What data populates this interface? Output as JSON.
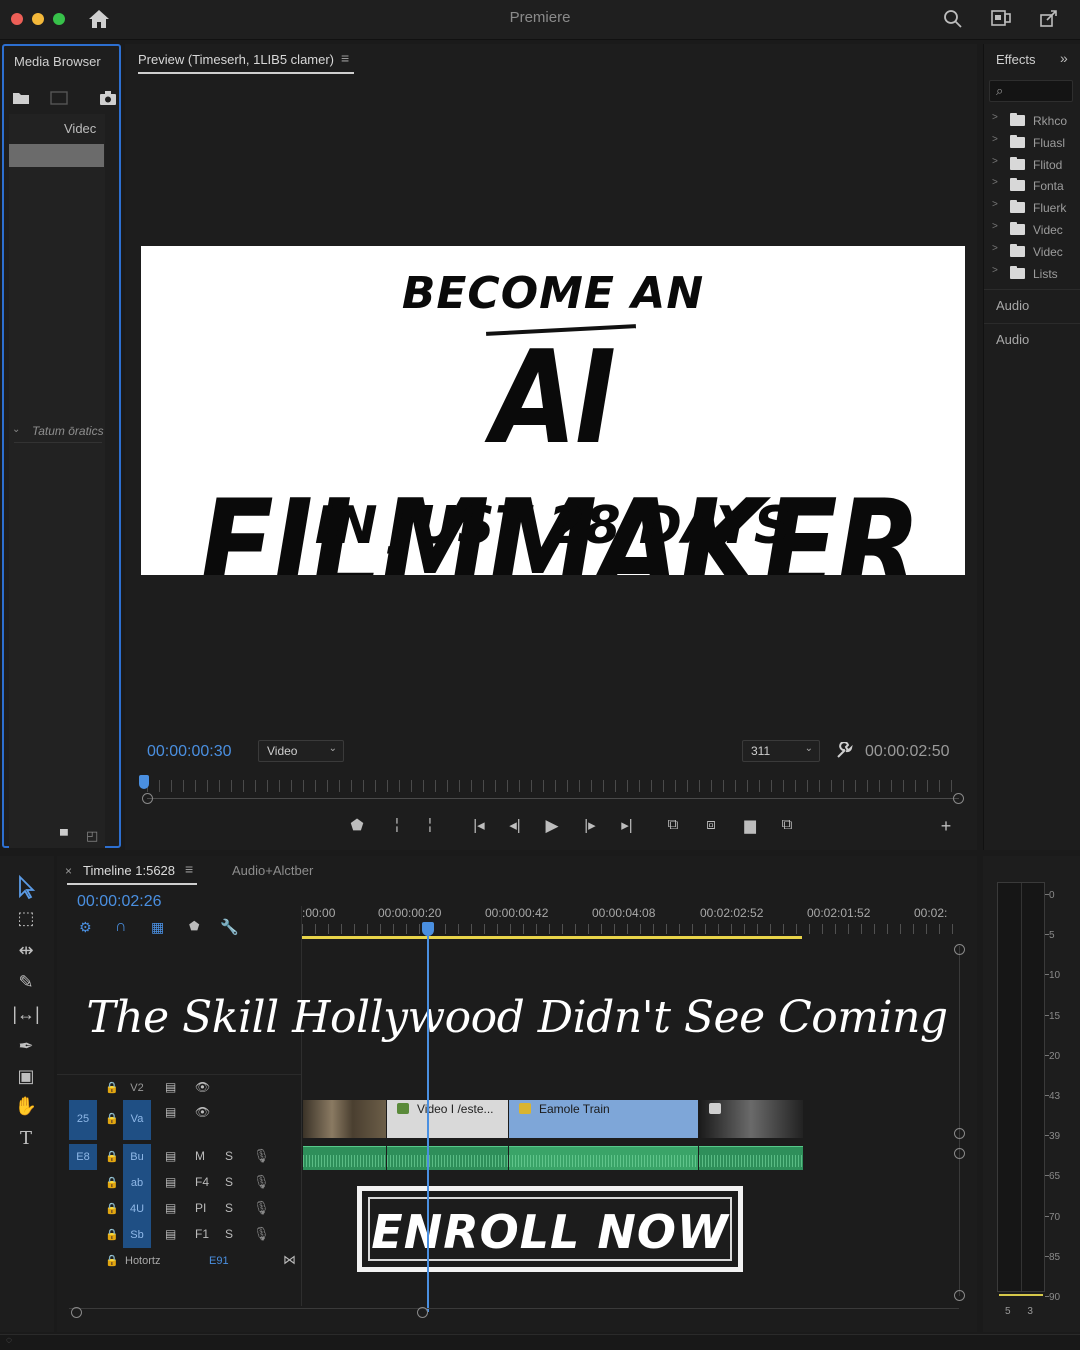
{
  "app": {
    "title": "Premiere"
  },
  "media_browser": {
    "tab": "Media Browser",
    "column": "Videc",
    "folder": "Tatum ōratics"
  },
  "preview": {
    "tab": "Preview (Timeserh, 1LIB5 clamer)",
    "frame": {
      "line1": "BECOME AN",
      "line2": "AI FILMMAKER",
      "line3": "IN JUST 28 DAYS"
    },
    "current_tc": "00:00:00:30",
    "mode_select": "Video",
    "zoom_select": "311",
    "duration_tc": "00:00:02:50"
  },
  "effects": {
    "tab": "Effects",
    "items": [
      {
        "label": "Rkhco"
      },
      {
        "label": "Fluasl"
      },
      {
        "label": "Flitod"
      },
      {
        "label": "Fonta"
      },
      {
        "label": "Fluerk"
      },
      {
        "label": "Videc"
      },
      {
        "label": "Videc"
      },
      {
        "label": "Lists"
      }
    ],
    "audio1": "Audio",
    "audio2": "Audio"
  },
  "timeline": {
    "tab": "Timeline 1:5628",
    "tab2": "Audio+Alctber",
    "tc": "00:00:02:26",
    "ruler": [
      ":00:00",
      "00:00:00:20",
      "00:00:00:42",
      "00:00:04:08",
      "00:02:02:52",
      "00:02:01:52",
      "00:02:"
    ],
    "tagline": "The Skill Hollywood Didn't See Coming",
    "tracks": {
      "v2": "V2",
      "v1": "Va",
      "v1_target": "25",
      "a1_target": "E8",
      "a1": "Bu",
      "a2": "ab",
      "a3": "4U",
      "a4": "Sb",
      "a1_m": "M",
      "a2_m": "F4",
      "a3_m": "PI",
      "a4_m": "F1",
      "solo": "S",
      "master": "Hotortz",
      "master_val": "E91"
    },
    "clips": [
      {
        "label": ""
      },
      {
        "label": "Video I /este..."
      },
      {
        "label": "Eamole Train"
      },
      {
        "label": ""
      }
    ],
    "enroll": "ENROLL NOW"
  },
  "meter": {
    "labels": [
      "0",
      "5",
      "10",
      "15",
      "20",
      "43",
      "39",
      "65",
      "70",
      "85",
      "90"
    ],
    "foot": "5 3"
  },
  "colors": {
    "accent_blue": "#4a8fe0",
    "work_area_yellow": "#e8d44a",
    "audio_green": "#2e8f5a",
    "clip_blue": "#7ea6d8"
  }
}
